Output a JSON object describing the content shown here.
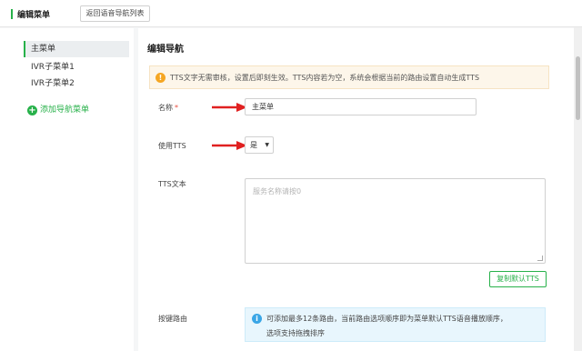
{
  "header": {
    "title": "编辑菜单",
    "back_button": "返回语音导航列表"
  },
  "sidebar": {
    "items": [
      {
        "label": "主菜单",
        "active": true
      },
      {
        "label": "IVR子菜单1",
        "active": false
      },
      {
        "label": "IVR子菜单2",
        "active": false
      }
    ],
    "add_label": "添加导航菜单",
    "add_icon": "plus-circle-icon"
  },
  "main": {
    "title": "编辑导航",
    "warning": "TTS文字无需审核，设置后即刻生效。TTS内容若为空，系统会根据当前的路由设置自动生成TTS",
    "name_label": "名称",
    "name_required_mark": "*",
    "name_value": "主菜单",
    "use_tts_label": "使用TTS",
    "use_tts_value": "是",
    "tts_text_label": "TTS文本",
    "tts_placeholder": "服务名称请按0",
    "copy_default_button": "复制默认TTS",
    "key_route_label": "按键路由",
    "info_line1": "可添加最多12条路由，当前路由选项顺序即为菜单默认TTS语音播放顺序，",
    "info_line2": "选项支持拖拽排序"
  },
  "colors": {
    "accent": "#27b14a",
    "warning": "#f5a623",
    "info": "#3aa6e6",
    "arrow": "#e02020"
  }
}
